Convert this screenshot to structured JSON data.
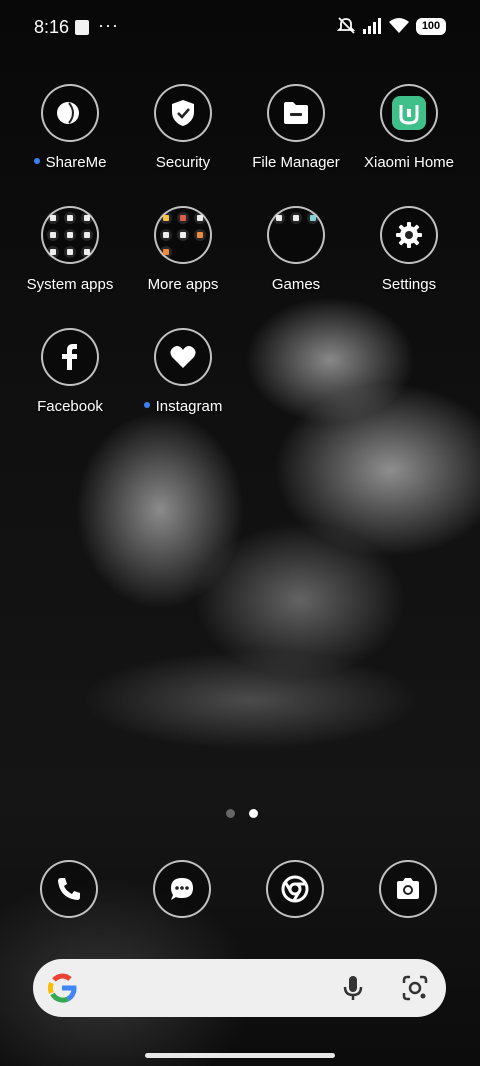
{
  "status_bar": {
    "time": "8:16",
    "overflow": "···",
    "battery": "100",
    "icons": [
      "notification-square-icon",
      "silent-icon",
      "signal-icon",
      "wifi-icon",
      "battery-icon"
    ]
  },
  "apps": [
    {
      "name": "ShareMe",
      "icon": "shareme-icon",
      "new": true
    },
    {
      "name": "Security",
      "icon": "shield-icon",
      "new": false
    },
    {
      "name": "File Manager",
      "icon": "folder-icon",
      "new": false
    },
    {
      "name": "Xiaomi Home",
      "icon": "xiaomi-home-icon",
      "new": false,
      "accent": "#3fbf8a"
    },
    {
      "name": "System apps",
      "icon": "folder-grid-icon",
      "new": false
    },
    {
      "name": "More apps",
      "icon": "folder-grid-icon",
      "new": false
    },
    {
      "name": "Games",
      "icon": "folder-grid-icon",
      "new": false
    },
    {
      "name": "Settings",
      "icon": "gear-icon",
      "new": false
    },
    {
      "name": "Facebook",
      "icon": "facebook-icon",
      "new": false
    },
    {
      "name": "Instagram",
      "icon": "heart-icon",
      "new": true
    }
  ],
  "page_indicator": {
    "count": 2,
    "active": 2
  },
  "dock": [
    {
      "name": "Phone",
      "icon": "phone-icon"
    },
    {
      "name": "Messages",
      "icon": "message-icon"
    },
    {
      "name": "Chrome",
      "icon": "chrome-icon"
    },
    {
      "name": "Camera",
      "icon": "camera-icon"
    }
  ],
  "search": {
    "logo": "google-icon",
    "right_icons": [
      "mic-icon",
      "lens-icon"
    ]
  },
  "colors": {
    "notification_dot": "#3b82f6",
    "xiaomi_home_green": "#3fbf8a"
  }
}
